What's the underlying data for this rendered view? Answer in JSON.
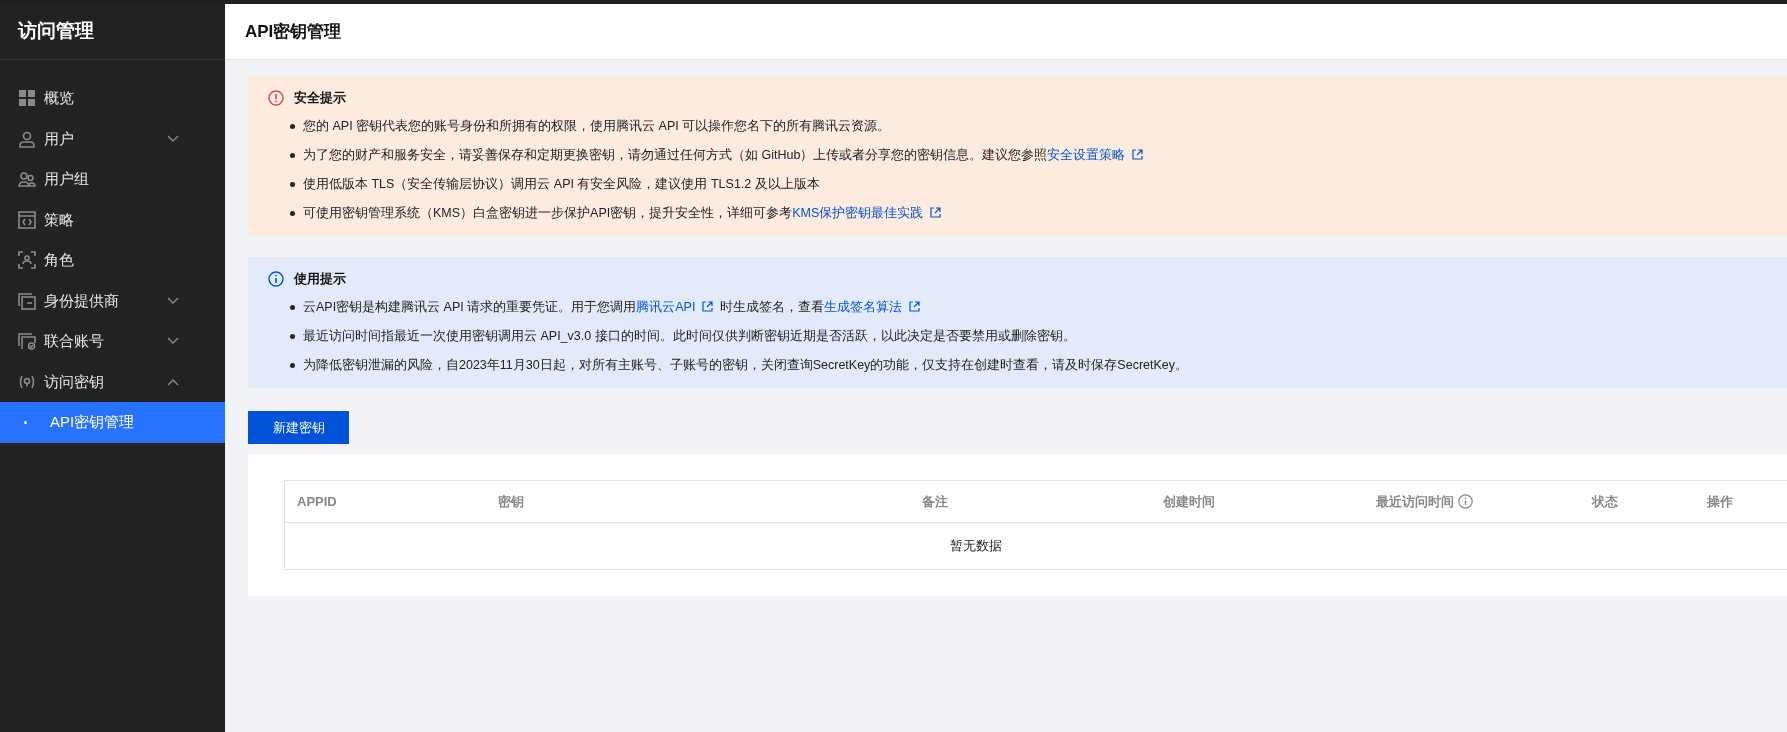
{
  "sidebar": {
    "title": "访问管理",
    "items": [
      {
        "kind": "link",
        "label": "概览",
        "selected": false
      },
      {
        "kind": "group",
        "label": "用户",
        "expanded": false,
        "selected": false
      },
      {
        "kind": "link",
        "label": "用户组",
        "selected": false
      },
      {
        "kind": "link",
        "label": "策略",
        "selected": false
      },
      {
        "kind": "link",
        "label": "角色",
        "selected": false
      },
      {
        "kind": "group",
        "label": "身份提供商",
        "expanded": false,
        "selected": false
      },
      {
        "kind": "group",
        "label": "联合账号",
        "expanded": false,
        "selected": false
      },
      {
        "kind": "group",
        "label": "访问密钥",
        "expanded": true,
        "selected": false,
        "children": [
          {
            "label": "API密钥管理",
            "selected": true
          }
        ]
      }
    ]
  },
  "page_title": "API密钥管理",
  "notices": [
    {
      "kind": "warning",
      "title": "安全提示",
      "items": [
        [
          {
            "kind": "text",
            "text": "您的 API 密钥代表您的账号身份和所拥有的权限，使用腾讯云 API 可以操作您名下的所有腾讯云资源。"
          }
        ],
        [
          {
            "kind": "text",
            "text": "为了您的财产和服务安全，请妥善保存和定期更换密钥，请勿通过任何方式（如 GitHub）上传或者分享您的密钥信息。建议您参照"
          },
          {
            "kind": "link",
            "text": "安全设置策略"
          }
        ],
        [
          {
            "kind": "text",
            "text": "使用低版本 TLS（安全传输层协议）调用云 API 有安全风险，建议使用 TLS1.2 及以上版本"
          }
        ],
        [
          {
            "kind": "text",
            "text": "可使用密钥管理系统（KMS）白盒密钥进一步保护API密钥，提升安全性，详细可参考"
          },
          {
            "kind": "link",
            "text": "KMS保护密钥最佳实践"
          }
        ]
      ]
    },
    {
      "kind": "info",
      "title": "使用提示",
      "items": [
        [
          {
            "kind": "text",
            "text": "云API密钥是构建腾讯云 API 请求的重要凭证。用于您调用"
          },
          {
            "kind": "link",
            "text": "腾讯云API"
          },
          {
            "kind": "text",
            "text": "时生成签名，查看"
          },
          {
            "kind": "link",
            "text": "生成签名算法"
          }
        ],
        [
          {
            "kind": "text",
            "text": "最近访问时间指最近一次使用密钥调用云 API_v3.0 接口的时间。此时间仅供判断密钥近期是否活跃，以此决定是否要禁用或删除密钥。"
          }
        ],
        [
          {
            "kind": "text",
            "text": "为降低密钥泄漏的风险，自2023年11月30日起，对所有主账号、子账号的密钥，关闭查询SecretKey的功能，仅支持在创建时查看，请及时保存SecretKey。"
          }
        ]
      ]
    }
  ],
  "create_button": "新建密钥",
  "table": {
    "columns": [
      {
        "kind": "plain",
        "label": "APPID"
      },
      {
        "kind": "plain",
        "label": "密钥"
      },
      {
        "kind": "plain",
        "label": "备注"
      },
      {
        "kind": "plain",
        "label": "创建时间"
      },
      {
        "kind": "info",
        "label": "最近访问时间"
      },
      {
        "kind": "plain",
        "label": "状态"
      },
      {
        "kind": "plain",
        "label": "操作"
      }
    ],
    "empty_text": "暂无数据"
  }
}
